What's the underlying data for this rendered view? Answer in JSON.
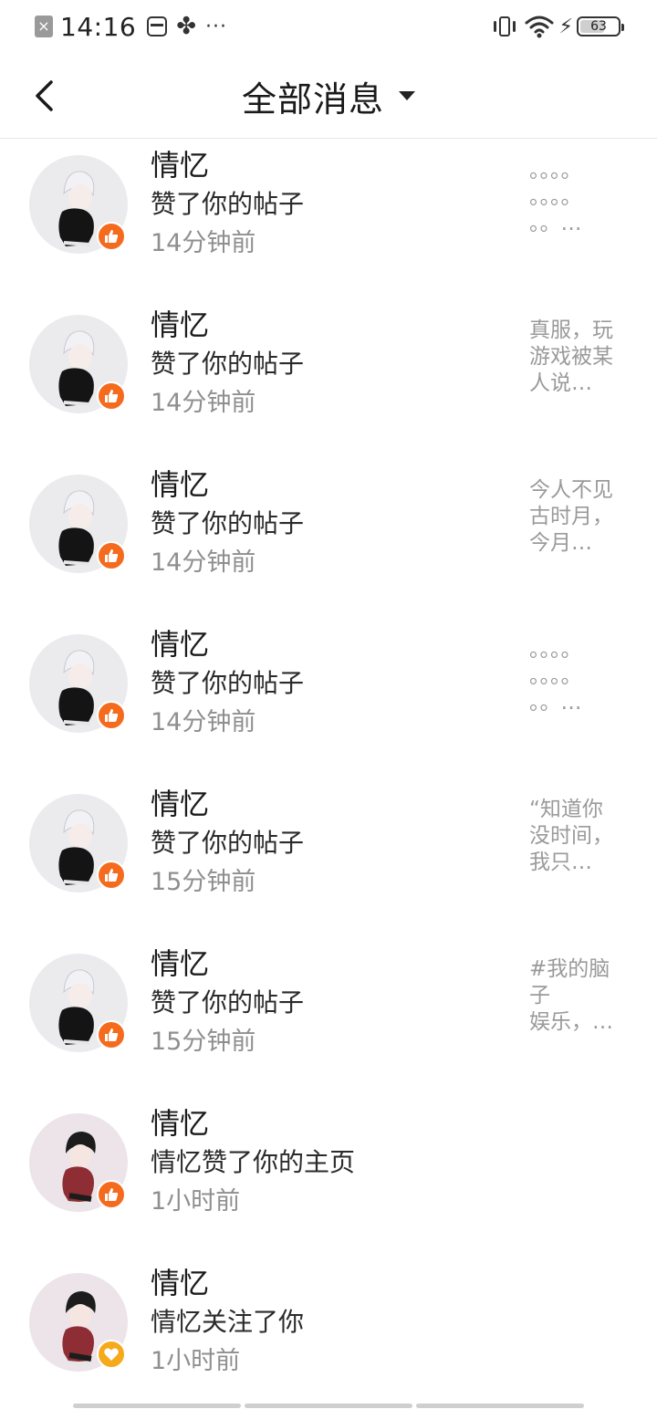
{
  "status_bar": {
    "time": "14:16",
    "dots": "···",
    "battery": "63"
  },
  "header": {
    "title": "全部消息"
  },
  "messages": [
    {
      "name": "情忆",
      "action": "赞了你的帖子",
      "time": "14分钟前",
      "preview": [
        "。。。。",
        "。。。。",
        "。。…"
      ],
      "badge": "like"
    },
    {
      "name": "情忆",
      "action": "赞了你的帖子",
      "time": "14分钟前",
      "preview": [
        "真服，玩",
        "游戏被某",
        "人说…"
      ],
      "badge": "like"
    },
    {
      "name": "情忆",
      "action": "赞了你的帖子",
      "time": "14分钟前",
      "preview": [
        "今人不见",
        "古时月，",
        "今月…"
      ],
      "badge": "like"
    },
    {
      "name": "情忆",
      "action": "赞了你的帖子",
      "time": "14分钟前",
      "preview": [
        "。。。。",
        "。。。。",
        "。。…"
      ],
      "badge": "like"
    },
    {
      "name": "情忆",
      "action": "赞了你的帖子",
      "time": "15分钟前",
      "preview": [
        "“知道你",
        "没时间，",
        "我只…"
      ],
      "badge": "like"
    },
    {
      "name": "情忆",
      "action": "赞了你的帖子",
      "time": "15分钟前",
      "preview": [
        "#我的脑",
        "子",
        "娱乐，…"
      ],
      "badge": "like"
    },
    {
      "name": "情忆",
      "action": "情忆赞了你的主页",
      "time": "1小时前",
      "preview": [],
      "badge": "like"
    },
    {
      "name": "情忆",
      "action": "情忆关注了你",
      "time": "1小时前",
      "preview": [],
      "badge": "follow"
    }
  ],
  "colors": {
    "like_badge": "#f46b1e",
    "follow_badge": "#f5a91b"
  }
}
